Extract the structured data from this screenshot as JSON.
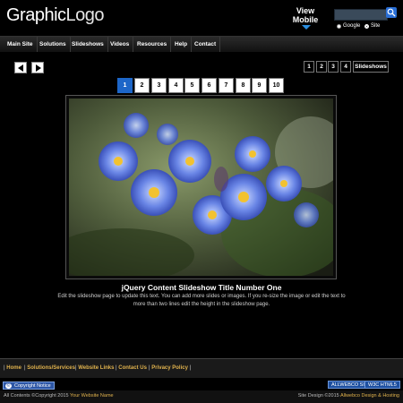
{
  "header": {
    "logo_bold": "Graphic",
    "logo_thin": "Logo",
    "view_mobile_line1": "View",
    "view_mobile_line2": "Mobile",
    "search": {
      "placeholder": "",
      "radio_google": "Google",
      "radio_site": "Site",
      "selected": "site"
    }
  },
  "nav": {
    "items": [
      {
        "label": "Main Site"
      },
      {
        "label": "Solutions"
      },
      {
        "label": "Slideshows"
      },
      {
        "label": "Videos"
      },
      {
        "label": "Resources"
      },
      {
        "label": "Help"
      },
      {
        "label": "Contact"
      }
    ]
  },
  "gallery_nav": {
    "small_pages": [
      "1",
      "2",
      "3",
      "4"
    ],
    "slideshows_label": "Slideshows"
  },
  "pager": {
    "pages": [
      "1",
      "2",
      "3",
      "4",
      "5",
      "6",
      "7",
      "8",
      "9",
      "10"
    ],
    "active": "1"
  },
  "slide": {
    "title": "jQuery Content Slideshow Title Number One",
    "description": "Edit the slideshow page to update this text. You can add more slides or images. If you re-size the image or edit the text to more than two lines edit the height in the slideshow page.",
    "image_name": "blue-forget-me-not-flowers"
  },
  "footer": {
    "links": [
      "Home",
      "Solutions/Services",
      "Website Links",
      "Contact Us",
      "Privacy Policy"
    ],
    "badge_css": "ALLWEBCO SITE",
    "badge_html": "W3C HTML5",
    "copyright_notice": "Copyright Notice",
    "bottom_left_prefix": "All Contents ©Copyright 2015",
    "bottom_left_site": "Your Website Name",
    "bottom_right_prefix": "Site Design ©2015",
    "bottom_right_site": "Allwebco Design & Hosting"
  },
  "colors": {
    "accent": "#1d66c8",
    "footer_link": "#e0b24d",
    "background": "#000000"
  }
}
